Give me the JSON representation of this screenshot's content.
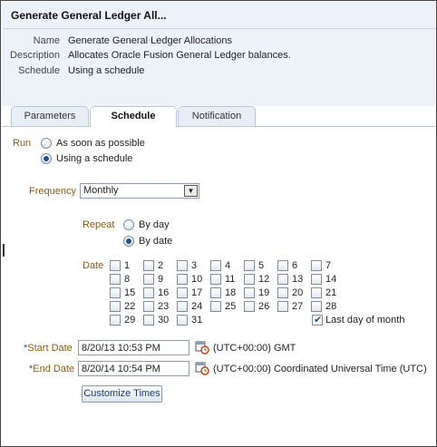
{
  "header": {
    "title": "Generate General Ledger All...",
    "fields": [
      {
        "label": "Name",
        "value": "Generate General Ledger Allocations"
      },
      {
        "label": "Description",
        "value": "Allocates Oracle Fusion General Ledger balances."
      },
      {
        "label": "Schedule",
        "value": "Using a schedule"
      }
    ]
  },
  "tabs": [
    {
      "label": "Parameters",
      "active": false
    },
    {
      "label": "Schedule",
      "active": true
    },
    {
      "label": "Notification",
      "active": false
    }
  ],
  "run": {
    "label": "Run",
    "options": [
      {
        "label": "As soon as possible",
        "checked": false
      },
      {
        "label": "Using a schedule",
        "checked": true
      }
    ]
  },
  "frequency": {
    "label": "Frequency",
    "value": "Monthly"
  },
  "repeat": {
    "label": "Repeat",
    "options": [
      {
        "label": "By day",
        "checked": false
      },
      {
        "label": "By date",
        "checked": true
      }
    ]
  },
  "date": {
    "label": "Date",
    "days": [
      "1",
      "2",
      "3",
      "4",
      "5",
      "6",
      "7",
      "8",
      "9",
      "10",
      "11",
      "12",
      "13",
      "14",
      "15",
      "16",
      "17",
      "18",
      "19",
      "20",
      "21",
      "22",
      "23",
      "24",
      "25",
      "26",
      "27",
      "28",
      "29",
      "30",
      "31"
    ],
    "last_day_label": "Last day of month",
    "last_day_checked": true
  },
  "start_date": {
    "required": "*",
    "label": "Start Date",
    "value": "8/20/13 10:53 PM",
    "timezone": "(UTC+00:00) GMT"
  },
  "end_date": {
    "required": "*",
    "label": "End Date",
    "value": "8/20/14 10:54 PM",
    "timezone": "(UTC+00:00) Coordinated Universal Time (UTC)"
  },
  "customize_button": "Customize Times",
  "colors": {
    "accent": "#2c4f86",
    "label": "#8a5a16",
    "header_bg": "#edf2f9"
  }
}
